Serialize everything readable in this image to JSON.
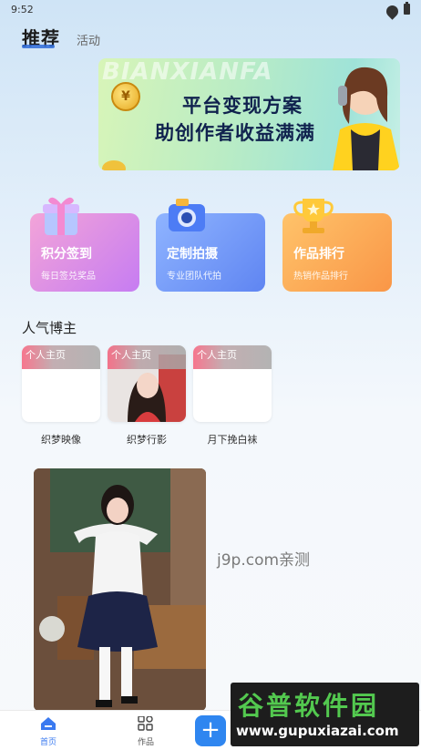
{
  "status_bar": {
    "time": "9:52"
  },
  "top_tabs": {
    "active": "推荐",
    "other": "活动"
  },
  "banner": {
    "bg_text": "BIANXIANFA",
    "coin_symbol": "¥",
    "line1": "平台变现方案",
    "line2": "助创作者收益满满"
  },
  "features": [
    {
      "title": "积分签到",
      "subtitle": "每日签兑奖品"
    },
    {
      "title": "定制拍摄",
      "subtitle": "专业团队代拍"
    },
    {
      "title": "作品排行",
      "subtitle": "热销作品排行"
    }
  ],
  "popular_section": {
    "title": "人气博主",
    "bloggers": [
      {
        "tag": "个人主页",
        "name": "织梦映像"
      },
      {
        "tag": "个人主页",
        "name": "织梦行影"
      },
      {
        "tag": "个人主页",
        "name": "月下挽白袜"
      }
    ]
  },
  "watermark": "j9p.com亲测",
  "bottom_nav": {
    "home": "首页",
    "works": "作品",
    "add": "+"
  },
  "brand_overlay": {
    "line1": "谷普软件园",
    "line2": "www.gupuxiazai.com"
  },
  "colors": {
    "accent": "#2f86f0",
    "nav_active": "#3a7af0"
  }
}
